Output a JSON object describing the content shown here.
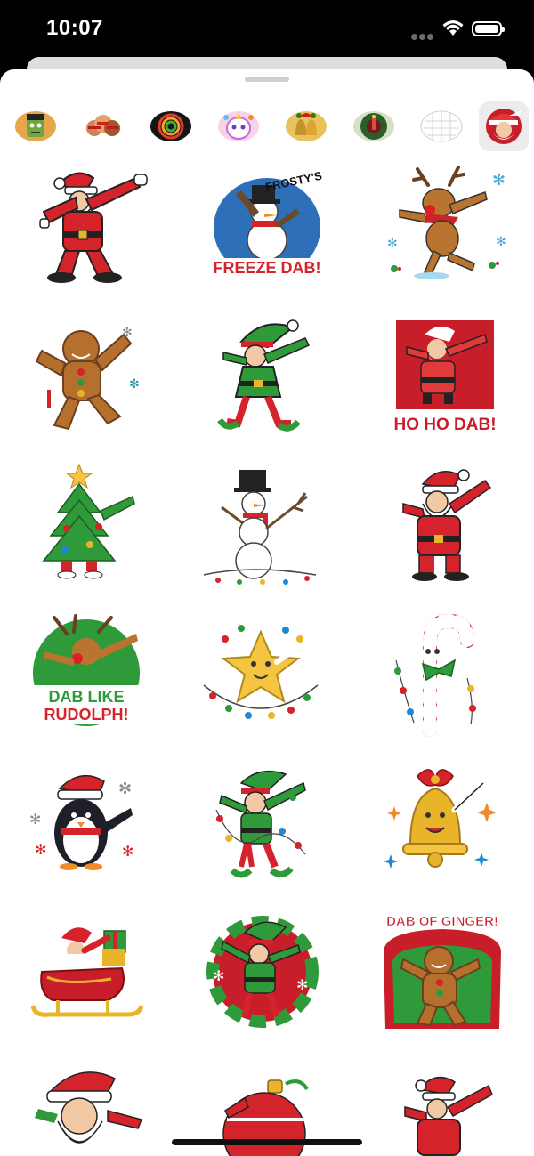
{
  "status_bar": {
    "time": "10:07"
  },
  "tabs": [
    {
      "name": "frankenstein-pack-icon",
      "selected": false
    },
    {
      "name": "faces-pack-icon",
      "selected": false
    },
    {
      "name": "rings-pack-icon",
      "selected": false
    },
    {
      "name": "unicorn-pack-icon",
      "selected": false
    },
    {
      "name": "bells-pack-icon",
      "selected": false
    },
    {
      "name": "wreath-pack-icon",
      "selected": false
    },
    {
      "name": "sketch-pack-icon",
      "selected": false
    },
    {
      "name": "christmas-dab-pack-icon",
      "selected": true
    }
  ],
  "stickers": [
    {
      "name": "dabbing-santa-sticker",
      "caption": ""
    },
    {
      "name": "frosty-freeze-dab-sticker",
      "caption": "FROSTY'S",
      "caption2": "FREEZE DAB!"
    },
    {
      "name": "dabbing-reindeer-sticker",
      "caption": ""
    },
    {
      "name": "dabbing-gingerbread-sticker",
      "caption": ""
    },
    {
      "name": "dabbing-elf-sticker",
      "caption": ""
    },
    {
      "name": "ho-ho-dab-santa-sticker",
      "caption": "HO HO DAB!"
    },
    {
      "name": "dabbing-christmas-tree-sticker",
      "caption": ""
    },
    {
      "name": "dabbing-snowman-sticker",
      "caption": ""
    },
    {
      "name": "dabbing-santa-sticker-2",
      "caption": ""
    },
    {
      "name": "dab-like-rudolph-sticker",
      "caption": "DAB LIKE",
      "caption2": "RUDOLPH!"
    },
    {
      "name": "dabbing-star-sticker",
      "caption": ""
    },
    {
      "name": "dabbing-candy-cane-sticker",
      "caption": ""
    },
    {
      "name": "dabbing-penguin-sticker",
      "caption": ""
    },
    {
      "name": "dabbing-elf-lights-sticker",
      "caption": ""
    },
    {
      "name": "dabbing-bell-sticker",
      "caption": ""
    },
    {
      "name": "dabbing-santa-sleigh-sticker",
      "caption": ""
    },
    {
      "name": "dabbing-elf-wreath-sticker",
      "caption": ""
    },
    {
      "name": "dab-of-ginger-sticker",
      "caption": "DAB OF GINGER!"
    },
    {
      "name": "santa-laughing-sticker",
      "caption": ""
    },
    {
      "name": "ornament-sticker",
      "caption": ""
    },
    {
      "name": "dabbing-santa-sticker-3",
      "caption": ""
    }
  ],
  "colors": {
    "red": "#d4232b",
    "green": "#2f9a3a",
    "gold": "#e8b42a",
    "skin": "#f2c9a5",
    "brown": "#a0622d"
  }
}
